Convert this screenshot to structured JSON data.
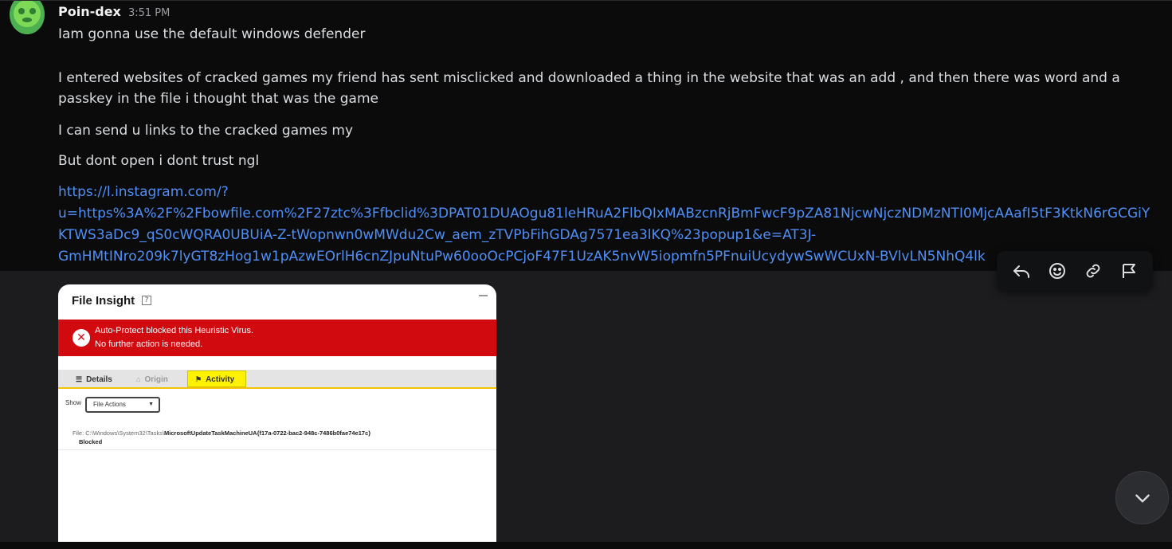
{
  "message": {
    "username": "Poin-dex",
    "timestamp": "3:51 PM",
    "lines": [
      "Iam gonna use the default windows defender",
      "I entered websites of cracked games my friend has sent misclicked and downloaded a thing in the website that was an add , and then there was word and a",
      "passkey in the file i thought that was the game",
      "I can send u links to the cracked games my",
      "But dont open i dont trust ngl"
    ],
    "link_lines": [
      "https://l.instagram.com/?",
      "u=https%3A%2F%2Fbowfile.com%2F27ztc%3Ffbclid%3DPAT01DUAOgu81leHRuA2FlbQIxMABzcnRjBmFwcF9pZA81NjcwNjczNDMzNTI0MjcAAafI5tF3KtkN6rGCGiY",
      "KTWS3aDc9_qS0cWQRA0UBUiA-Z-tWopnwn0wMWdu2Cw_aem_zTVPbFihGDAg7571ea3lKQ%23popup1&e=AT3J-",
      "GmHMtINro209k7lyGT8zHog1w1pAzwEOrlH6cnZJpuNtuPw60ooOcPCjoF47F1UzAK5nvW5iopmfn5PFnuiUcydywSwWCUxN-BVlvLN5NhQ4lk"
    ]
  },
  "toolbar": {
    "icons": [
      "reply-icon",
      "emoji-icon",
      "link-icon",
      "flag-icon"
    ]
  },
  "attachment": {
    "title": "File Insight",
    "help_glyph": "?",
    "alert_line1": "Auto-Protect blocked this Heuristic Virus.",
    "alert_line2": "No further action is needed.",
    "tabs": [
      "Details",
      "Origin",
      "Activity"
    ],
    "show_label": "Show",
    "show_value": "File Actions",
    "file_prefix": "File: C:\\Windows\\System32\\Tasks\\",
    "file_name": "MicrosoftUpdateTaskMachineUA{f17a-0722-bac2-948c-7486b0fae74e17c}",
    "status": "Blocked",
    "colors": {
      "alert": "#d10a10",
      "active_tab": "#fff200",
      "link": "#4f8ff7"
    }
  },
  "jump_button_icon": "chevron-down-icon"
}
